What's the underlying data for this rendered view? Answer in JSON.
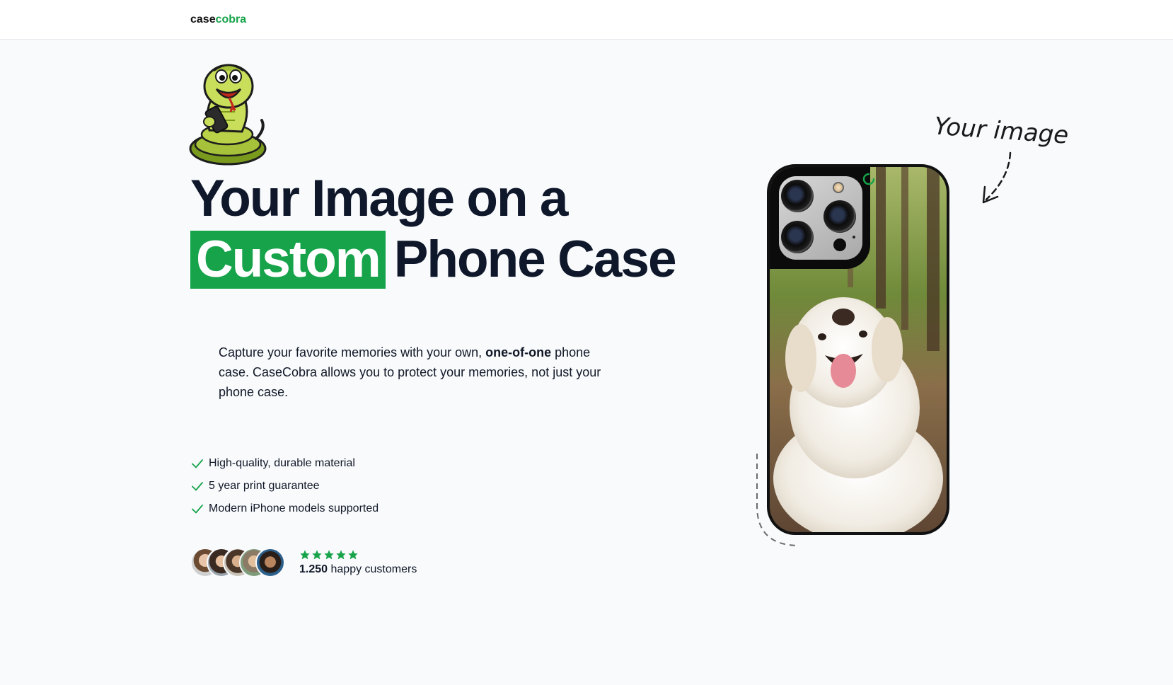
{
  "nav": {
    "logo_part1": "case",
    "logo_part2": "cobra"
  },
  "hero": {
    "title_line1": "Your Image on a",
    "title_highlight": "Custom",
    "title_line2_rest": "Phone Case",
    "description_before": "Capture your favorite memories with your own, ",
    "description_bold": "one-of-one",
    "description_after": " phone case. CaseCobra allows you to protect your memories, not just your phone case."
  },
  "features": [
    {
      "label": "High-quality, durable material",
      "icon": "check-icon"
    },
    {
      "label": "5 year print guarantee",
      "icon": "check-icon"
    },
    {
      "label": "Modern iPhone models supported",
      "icon": "check-icon"
    }
  ],
  "social_proof": {
    "rating_stars": 5,
    "count": "1.250",
    "count_label": " happy customers",
    "avatars": [
      "user-avatar-1",
      "user-avatar-2",
      "user-avatar-3",
      "user-avatar-4",
      "user-avatar-5"
    ]
  },
  "annotation": {
    "text": "Your image"
  },
  "colors": {
    "accent": "#16a34a",
    "background": "#f8fafc",
    "text": "#0f172a"
  }
}
